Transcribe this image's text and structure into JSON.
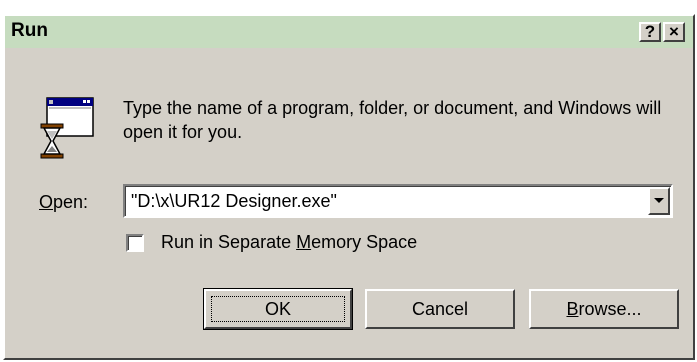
{
  "window": {
    "title": "Run",
    "help_label": "?",
    "close_label": "×"
  },
  "description": "Type the name of a program, folder, or document, and Windows will open it for you.",
  "open": {
    "label_mnemonic": "O",
    "label_rest": "pen:",
    "value": "\"D:\\x\\UR12 Designer.exe\""
  },
  "checkbox": {
    "label_pre": "Run in Separate ",
    "label_mnemonic": "M",
    "label_post": "emory Space",
    "checked": false
  },
  "buttons": {
    "ok": "OK",
    "cancel": "Cancel",
    "browse_mnemonic": "B",
    "browse_rest": "rowse..."
  },
  "icons": {
    "program": "run-program-icon",
    "dropdown": "chevron-down-icon"
  },
  "colors": {
    "titlebar": "#c6dcbf",
    "face": "#d4d0c8"
  }
}
